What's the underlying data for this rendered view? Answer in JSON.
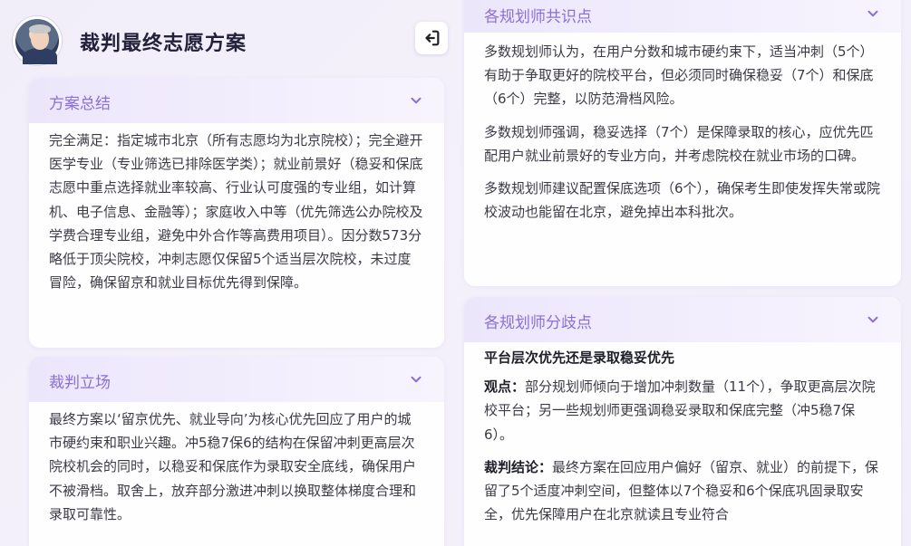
{
  "header": {
    "title": "裁判最终志愿方案"
  },
  "summary": {
    "title": "方案总结",
    "text": "完全满足：指定城市北京（所有志愿均为北京院校）；完全避开医学专业（专业筛选已排除医学类）；就业前景好（稳妥和保底志愿中重点选择就业率较高、行业认可度强的专业组，如计算机、电子信息、金融等）；家庭收入中等（优先筛选公办院校及学费合理专业组，避免中外合作等高费用项目）。因分数573分略低于顶尖院校，冲刺志愿仅保留5个适当层次院校，未过度冒险，确保留京和就业目标优先得到保障。"
  },
  "stance": {
    "title": "裁判立场",
    "text": "最终方案以‘留京优先、就业导向’为核心优先回应了用户的城市硬约束和职业兴趣。冲5稳7保6的结构在保留冲刺更高层次院校机会的同时，以稳妥和保底作为录取安全底线，确保用户不被滑档。取舍上，放弃部分激进冲刺以换取整体梯度合理和录取可靠性。"
  },
  "consensus": {
    "title": "各规划师共识点",
    "p1": "多数规划师认为，在用户分数和城市硬约束下，适当冲刺（5个）有助于争取更好的院校平台，但必须同时确保稳妥（7个）和保底（6个）完整，以防范滑档风险。",
    "p2": "多数规划师强调，稳妥选择（7个）是保障录取的核心，应优先匹配用户就业前景好的专业方向，并考虑院校在就业市场的口碑。",
    "p3": "多数规划师建议配置保底选项（6个），确保考生即使发挥失常或院校波动也能留在北京，避免掉出本科批次。"
  },
  "divergence": {
    "title": "各规划师分歧点",
    "subtitle": "平台层次优先还是录取稳妥优先",
    "view_label": "观点：",
    "view_text": "部分规划师倾向于增加冲刺数量（11个），争取更高层次院校平台；另一些规划师更强调稳妥录取和保底完整（冲5稳7保6）。",
    "verdict_label": "裁判结论：",
    "verdict_text": "最终方案在回应用户偏好（留京、就业）的前提下，保留了5个适度冲刺空间，但整体以7个稳妥和6个保底巩固录取安全，优先保障用户在北京就读且专业符合"
  },
  "colors": {
    "accent": "#8c6fd6",
    "title": "#23213a",
    "text": "#3b3b45"
  }
}
